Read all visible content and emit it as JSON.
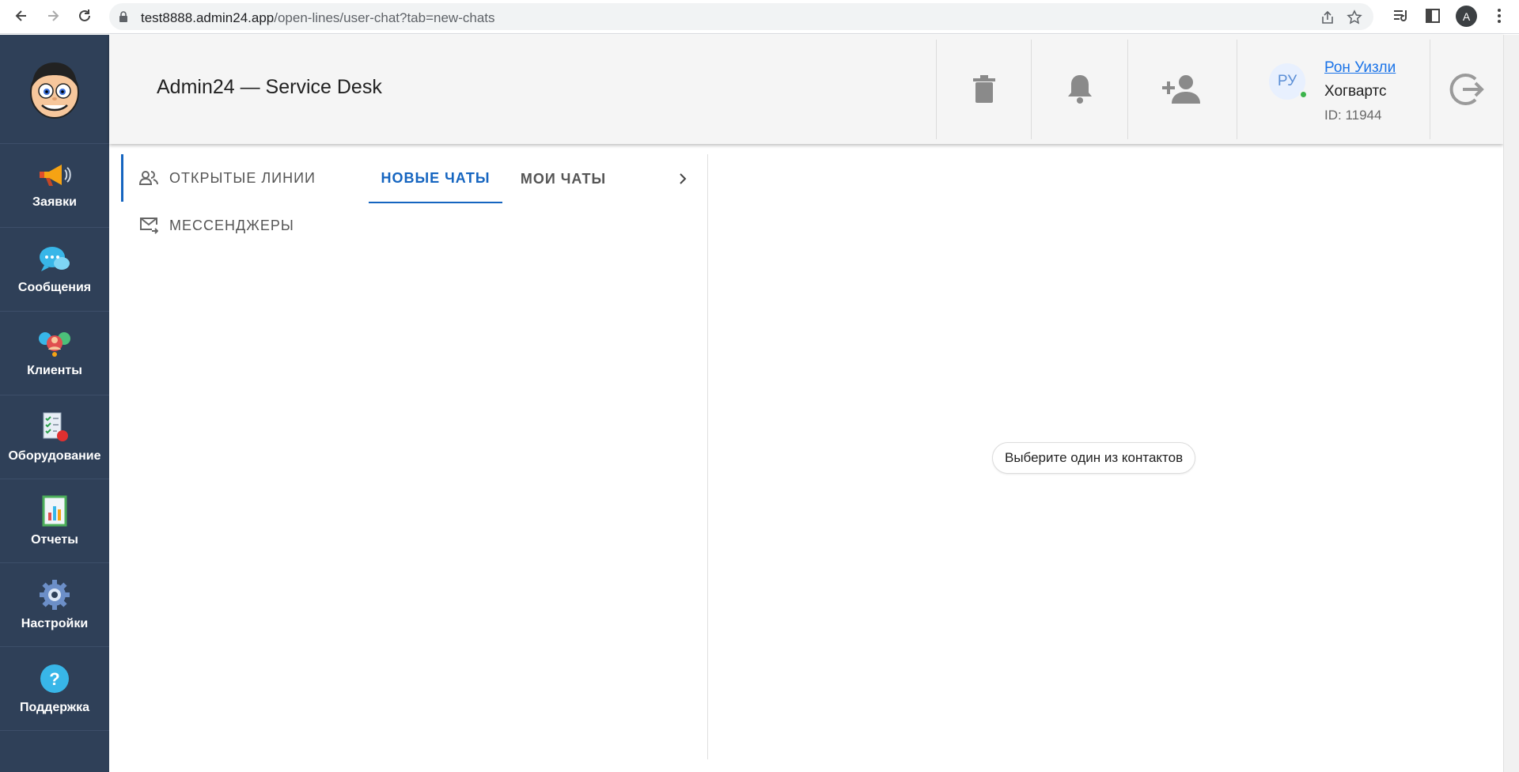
{
  "browser": {
    "url_host": "test8888.admin24.app",
    "url_path": "/open-lines/user-chat?tab=new-chats",
    "profile_initial": "A"
  },
  "sidebar": {
    "items": [
      {
        "label": "Заявки",
        "icon": "megaphone-icon"
      },
      {
        "label": "Сообщения",
        "icon": "chat-bubbles-icon"
      },
      {
        "label": "Клиенты",
        "icon": "clients-icon"
      },
      {
        "label": "Оборудование",
        "icon": "equipment-checklist-icon"
      },
      {
        "label": "Отчеты",
        "icon": "reports-icon"
      },
      {
        "label": "Настройки",
        "icon": "gear-icon"
      },
      {
        "label": "Поддержка",
        "icon": "help-icon"
      }
    ]
  },
  "header": {
    "title": "Admin24 — Service Desk",
    "user": {
      "initials": "РУ",
      "name": "Рон Уизли",
      "org": "Хогвартс",
      "id": "ID: 11944"
    }
  },
  "left_panel": {
    "menu": [
      {
        "label": "ОТКРЫТЫЕ ЛИНИИ",
        "icon": "people-icon"
      },
      {
        "label": "МЕССЕНДЖЕРЫ",
        "icon": "mail-forward-icon"
      }
    ],
    "tabs": [
      {
        "label": "НОВЫЕ ЧАТЫ",
        "active": true
      },
      {
        "label": "МОИ ЧАТЫ",
        "active": false
      }
    ]
  },
  "right_panel": {
    "empty_message": "Выберите один из контактов"
  },
  "colors": {
    "sidebar_bg": "#2f4058",
    "accent": "#1565c0",
    "online": "#3cb44b"
  }
}
